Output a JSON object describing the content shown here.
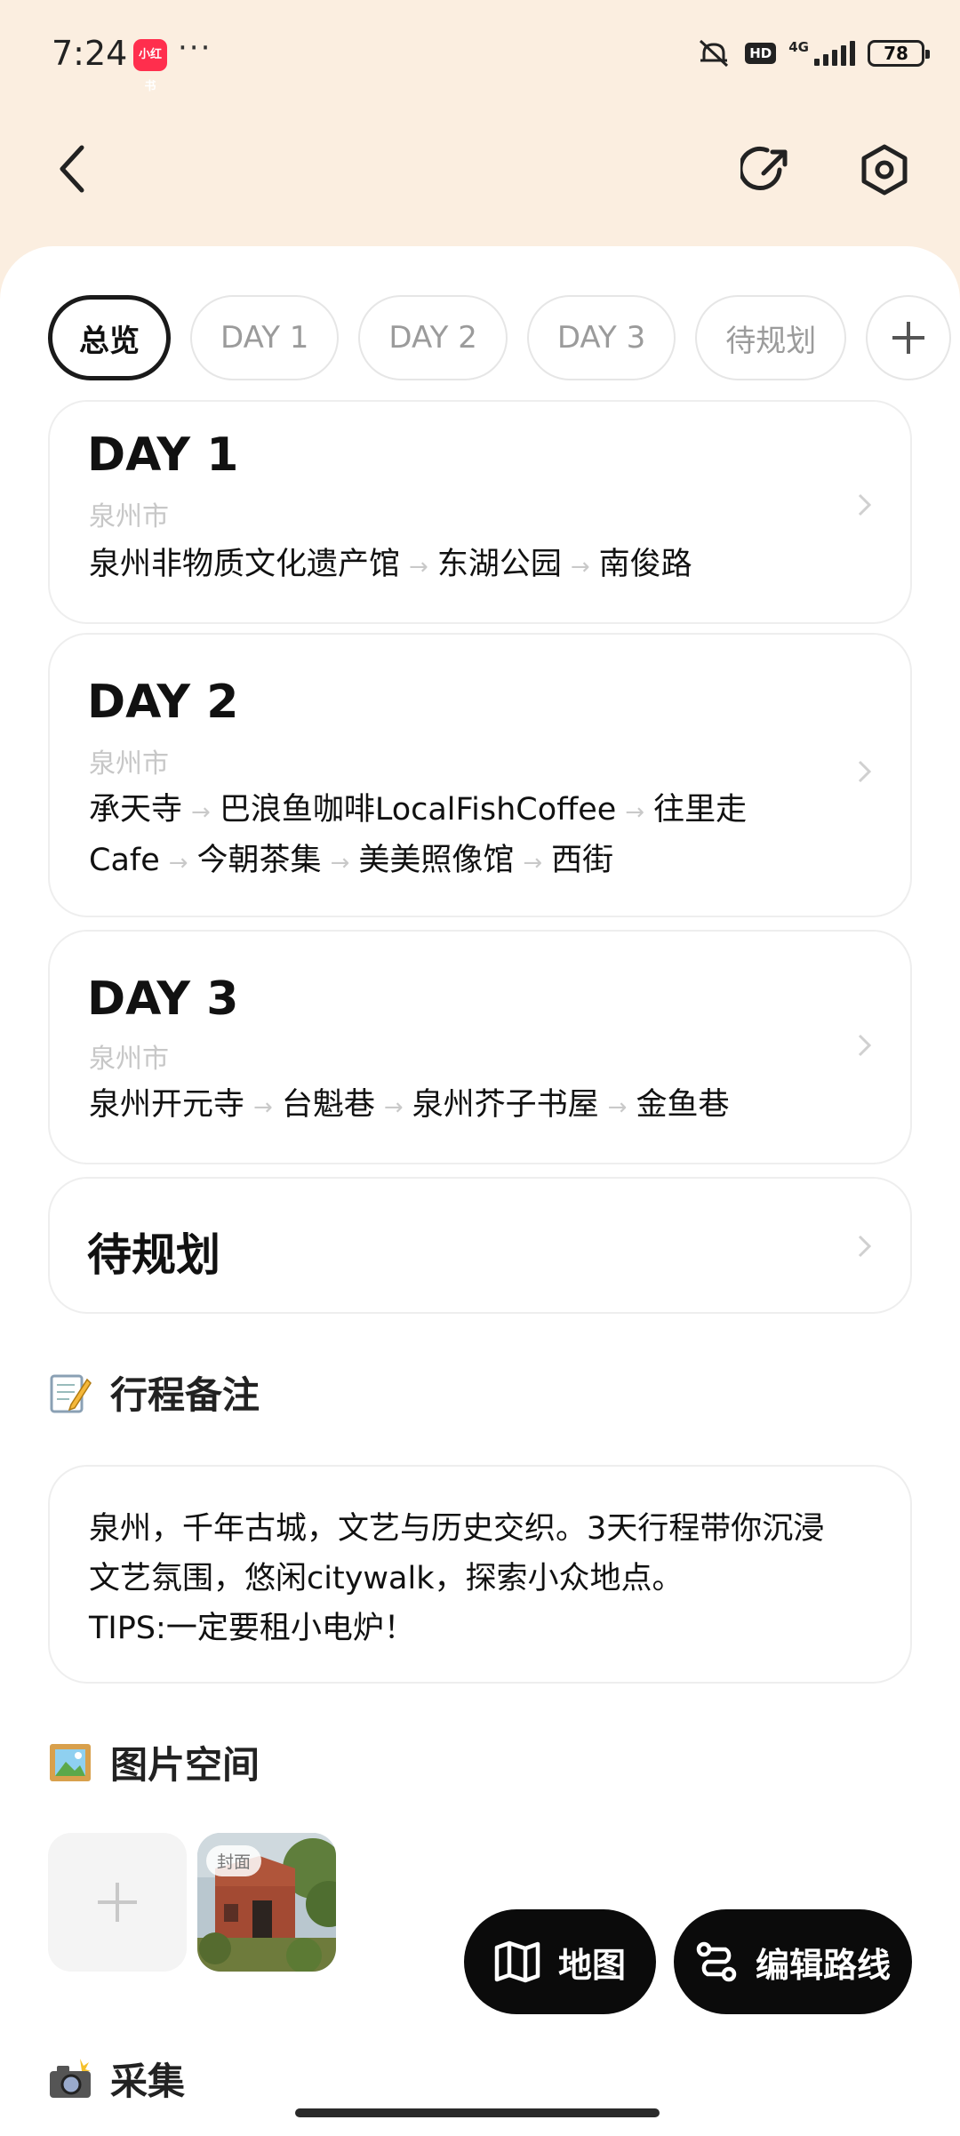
{
  "status_bar": {
    "time": "7:24",
    "app_badge": "小红书",
    "more": "···",
    "hd": "HD",
    "network": "4G",
    "battery": "78"
  },
  "tabs": [
    {
      "label": "总览",
      "active": true
    },
    {
      "label": "DAY 1",
      "active": false
    },
    {
      "label": "DAY 2",
      "active": false
    },
    {
      "label": "DAY 3",
      "active": false
    },
    {
      "label": "待规划",
      "active": false
    },
    {
      "label": "+",
      "active": false
    }
  ],
  "days": [
    {
      "title": "DAY 1",
      "city": "泉州市",
      "stops": [
        "泉州非物质文化遗产馆",
        "东湖公园",
        "南俊路"
      ]
    },
    {
      "title": "DAY 2",
      "city": "泉州市",
      "stops": [
        "承天寺",
        "巴浪鱼咖啡LocalFishCoffee",
        "往里走",
        "Cafe",
        "今朝茶集",
        "美美照像馆",
        "西街"
      ]
    },
    {
      "title": "DAY 3",
      "city": "泉州市",
      "stops": [
        "泉州开元寺",
        "台魁巷",
        "泉州芥子书屋",
        "金鱼巷"
      ]
    }
  ],
  "pending": {
    "title": "待规划"
  },
  "notes": {
    "heading": "行程备注",
    "emoji": "📝",
    "text": "泉州，千年古城，文艺与历史交织。3天行程带你沉浸\n文艺氛围，悠闲citywalk，探索小众地点。\nTIPS:一定要租小电炉！"
  },
  "photos": {
    "heading": "图片空间",
    "emoji": "🖼️",
    "cover_label": "封面"
  },
  "collect": {
    "heading": "采集",
    "emoji": "📸"
  },
  "fab": {
    "map_label": "地图",
    "edit_label": "编辑路线"
  },
  "colors": {
    "header_bg": "#fbeee0",
    "accent_dark": "#0b0b0b",
    "muted": "#c7c7c7"
  }
}
